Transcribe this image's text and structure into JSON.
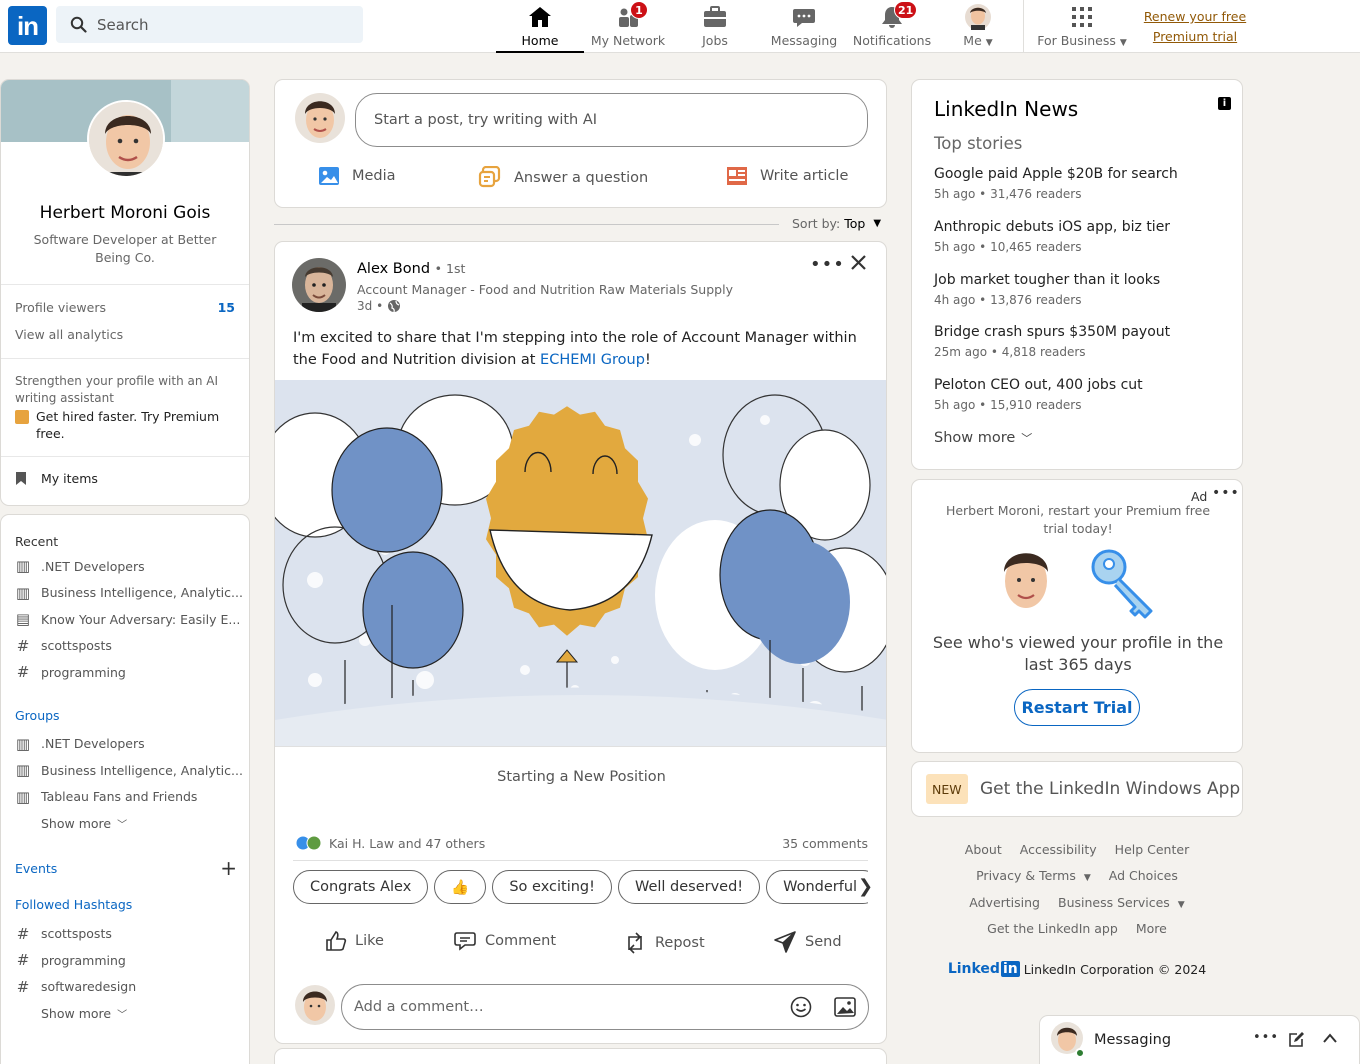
{
  "header": {
    "logo": "in",
    "search_placeholder": "Search",
    "nav": [
      {
        "label": "Home",
        "icon": "home-icon",
        "badge": ""
      },
      {
        "label": "My Network",
        "icon": "network-icon",
        "badge": "1"
      },
      {
        "label": "Jobs",
        "icon": "briefcase-icon",
        "badge": ""
      },
      {
        "label": "Messaging",
        "icon": "chat-icon",
        "badge": ""
      },
      {
        "label": "Notifications",
        "icon": "bell-icon",
        "badge": "21"
      },
      {
        "label": "Me",
        "icon": "avatar-icon",
        "badge": ""
      },
      {
        "label": "For Business",
        "icon": "grid-icon",
        "badge": ""
      }
    ],
    "premium_line1": "Renew your free",
    "premium_line2": "Premium trial"
  },
  "profile": {
    "name": "Herbert Moroni Gois",
    "headline": "Software Developer at Better Being Co.",
    "viewers_label": "Profile viewers",
    "viewers_count": "15",
    "analytics": "View all analytics",
    "promo_text": "Strengthen your profile with an AI writing assistant",
    "promo_cta": "Get hired faster. Try Premium free.",
    "my_items": "My items"
  },
  "sidebar": {
    "recent_title": "Recent",
    "recent": [
      ".NET Developers",
      "Business Intelligence, Analytic...",
      "Know Your Adversary: Easily E...",
      "scottsposts",
      "programming"
    ],
    "groups_title": "Groups",
    "groups": [
      ".NET Developers",
      "Business Intelligence, Analytic...",
      "Tableau Fans and Friends"
    ],
    "show_more": "Show more",
    "events_title": "Events",
    "hashtags_title": "Followed Hashtags",
    "hashtags": [
      "scottsposts",
      "programming",
      "softwaredesign"
    ]
  },
  "compose": {
    "placeholder": "Start a post, try writing with AI",
    "media": "Media",
    "question": "Answer a question",
    "article": "Write article"
  },
  "sort": {
    "label": "Sort by:",
    "value": "Top"
  },
  "post": {
    "author": "Alex Bond",
    "degree": "• 1st",
    "subtitle": "Account Manager - Food and Nutrition Raw Materials Supply",
    "time": "3d •",
    "text_before": "I'm excited to share that I'm stepping into the role of Account Manager within the Food and Nutrition division at ",
    "link": "ECHEMI Group",
    "text_after": "!",
    "caption": "Starting a New Position",
    "reactions": "Kai H. Law and 47 others",
    "comments": "35 comments",
    "chips": [
      "Congrats Alex",
      "👍",
      "So exciting!",
      "Well deserved!",
      "Wonderful!"
    ],
    "like": "Like",
    "comment": "Comment",
    "repost": "Repost",
    "send": "Send",
    "comment_placeholder": "Add a comment…"
  },
  "news": {
    "title": "LinkedIn News",
    "subtitle": "Top stories",
    "items": [
      {
        "title": "Google paid Apple $20B for search",
        "meta": "5h ago • 31,476 readers"
      },
      {
        "title": "Anthropic debuts iOS app, biz tier",
        "meta": "5h ago • 10,465 readers"
      },
      {
        "title": "Job market tougher than it looks",
        "meta": "4h ago • 13,876 readers"
      },
      {
        "title": "Bridge crash spurs $350M payout",
        "meta": "25m ago • 4,818 readers"
      },
      {
        "title": "Peloton CEO out, 400 jobs cut",
        "meta": "5h ago • 15,910 readers"
      }
    ],
    "show_more": "Show more"
  },
  "ad": {
    "label": "Ad",
    "text": "Herbert Moroni, restart your Premium free trial today!",
    "headline": "See who's viewed your profile in the last 365 days",
    "button": "Restart Trial"
  },
  "winapp": {
    "badge": "NEW",
    "text": "Get the LinkedIn Windows App"
  },
  "footer": {
    "row1": [
      "About",
      "Accessibility",
      "Help Center"
    ],
    "row2": [
      "Privacy & Terms",
      "Ad Choices"
    ],
    "row3": [
      "Advertising",
      "Business Services"
    ],
    "row4": [
      "Get the LinkedIn app",
      "More"
    ],
    "brand": "Linked",
    "copyright": "LinkedIn Corporation © 2024"
  },
  "messaging": {
    "label": "Messaging"
  },
  "colors": {
    "brand": "#0a66c2",
    "premium": "#915907",
    "badge": "#cc1016",
    "balloon_blue": "#7092c6",
    "sun": "#e2a93e"
  }
}
